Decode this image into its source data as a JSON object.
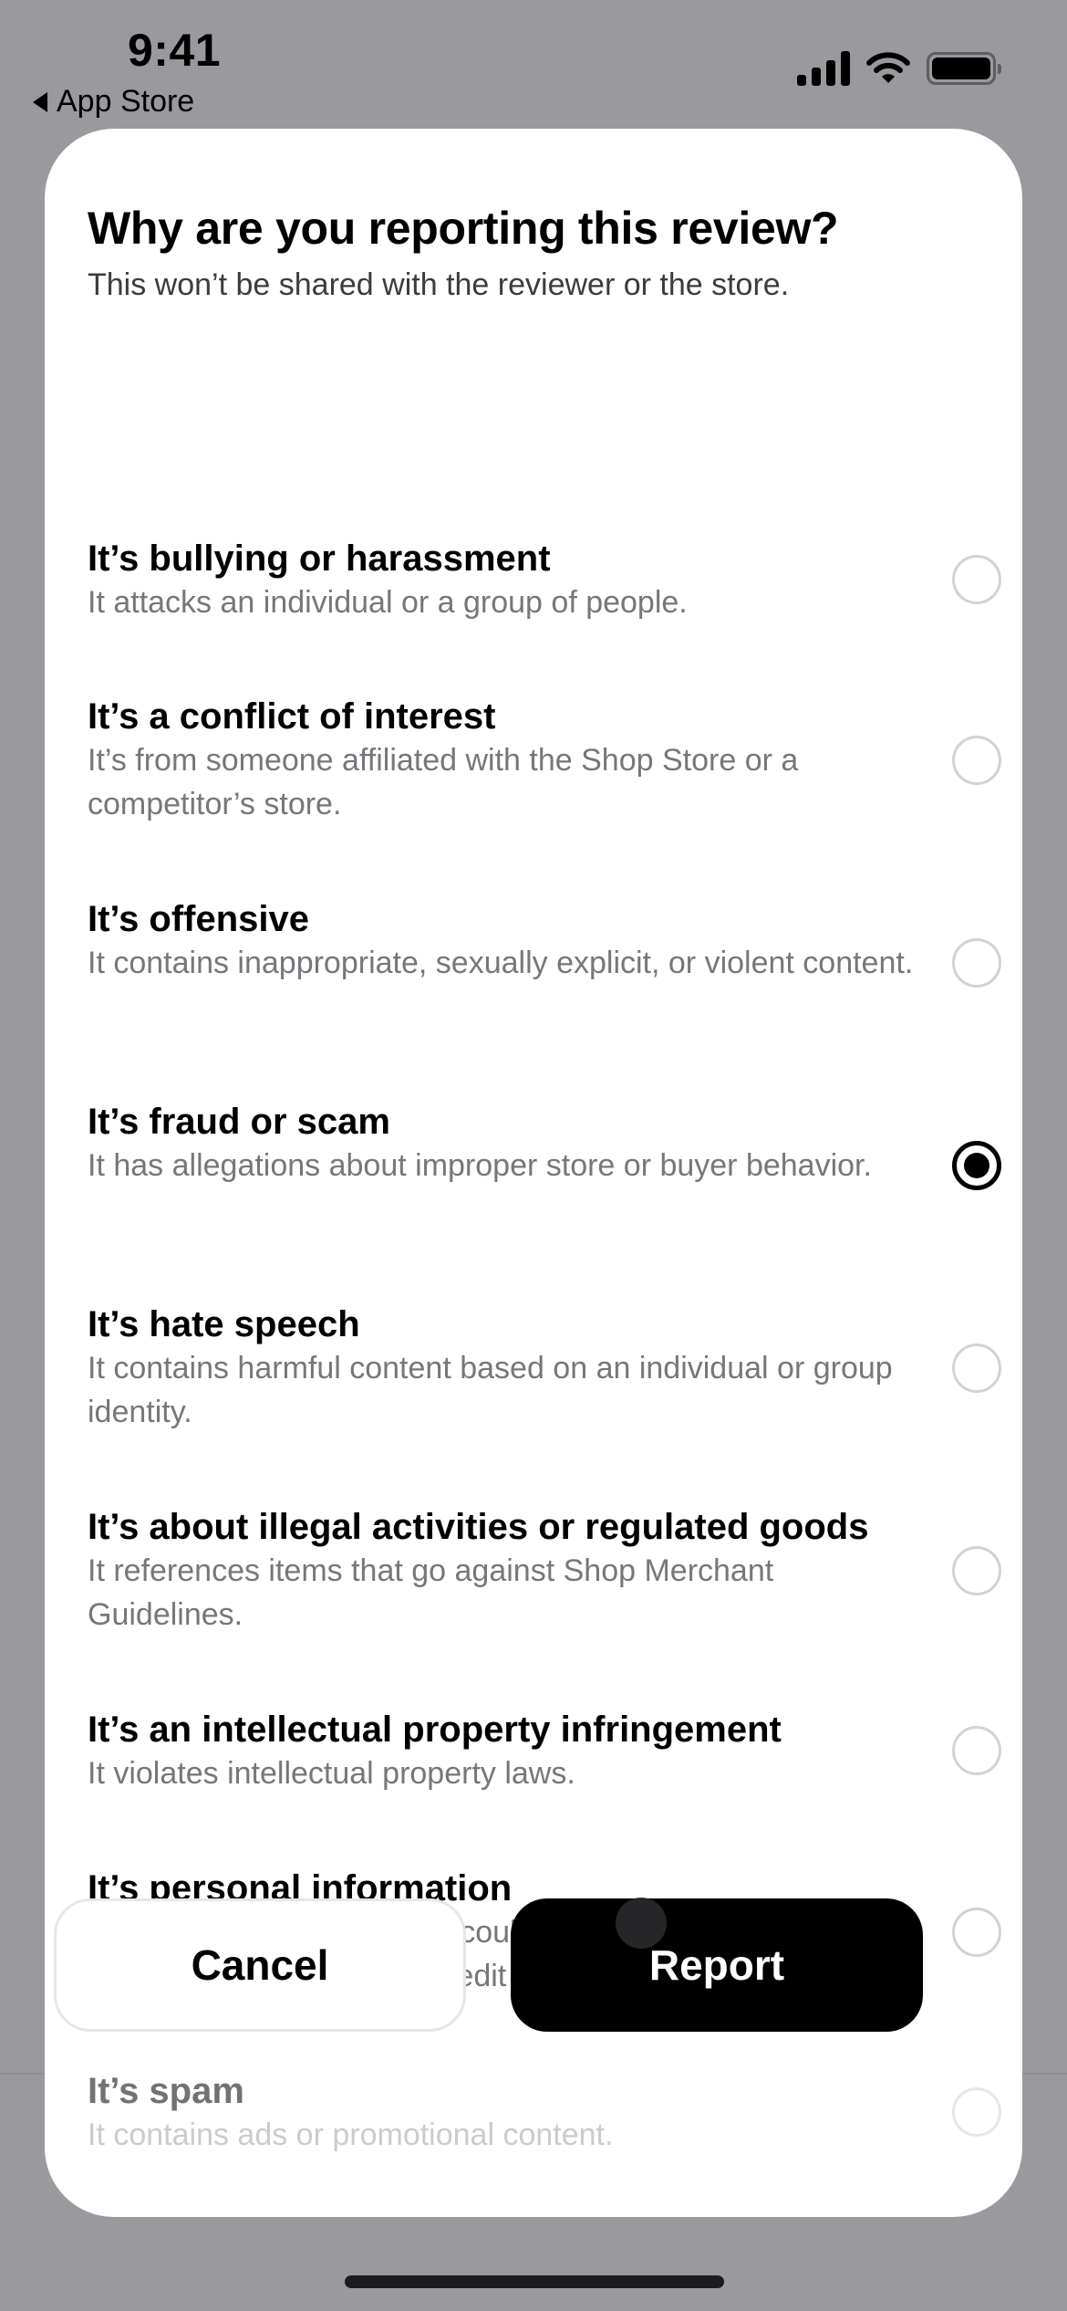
{
  "status_bar": {
    "time": "9:41",
    "back_app_label": "App Store",
    "icons": [
      "cellular-signal-icon",
      "wifi-icon",
      "battery-icon"
    ]
  },
  "sheet": {
    "title": "Why are you reporting this review?",
    "subtitle": "This won’t be shared with the reviewer or the store.",
    "options": [
      {
        "title": "It’s bullying or harassment",
        "description": "It attacks an individual or a group of people.",
        "selected": false
      },
      {
        "title": "It’s a conflict of interest",
        "description": "It’s from someone affiliated with the Shop Store or a competitor’s store.",
        "selected": false
      },
      {
        "title": "It’s offensive",
        "description": "It contains inappropriate, sexually explicit, or violent content.",
        "selected": false
      },
      {
        "title": "It’s fraud or scam",
        "description": "It has allegations about improper store or buyer behavior.",
        "selected": true
      },
      {
        "title": "It’s hate speech",
        "description": "It contains harmful content based on an individual or group identity.",
        "selected": false
      },
      {
        "title": "It’s about illegal activities or regulated goods",
        "description": "It references items that go against Shop Merchant Guidelines.",
        "selected": false
      },
      {
        "title": "It’s an intellectual property infringement",
        "description": "It violates intellectual property laws.",
        "selected": false
      },
      {
        "title": "It’s personal information",
        "description": "It contains information that could identify the reviewer e.g. email, phone number, or credit card details.",
        "selected": false
      },
      {
        "title": "It’s spam",
        "description": "It contains ads or promotional content.",
        "selected": false
      }
    ],
    "cancel_label": "Cancel",
    "report_label": "Report"
  },
  "colors": {
    "backdrop": "#9a999e",
    "primary_button": "#000000",
    "secondary_text": "#77767b",
    "radio_border": "#d2d2d4"
  }
}
